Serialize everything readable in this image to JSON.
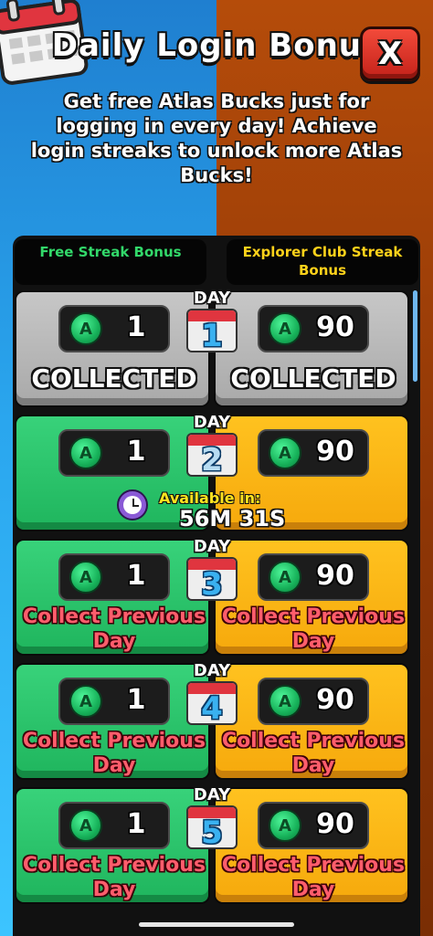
{
  "header": {
    "title": "Daily Login Bonus",
    "close_label": "X",
    "subtitle": "Get free Atlas Bucks just for logging in every day! Achieve login streaks to unlock more Atlas Bucks!"
  },
  "columns": {
    "free_header": "Free Streak Bonus",
    "club_header": "Explorer Club Streak Bonus"
  },
  "currency_icon_letter": "A",
  "days": [
    {
      "day_label": "DAY",
      "day_number": "1",
      "free_amount": "1",
      "club_amount": "90",
      "state": "collected",
      "status_text": "COLLECTED"
    },
    {
      "day_label": "DAY",
      "day_number": "2",
      "free_amount": "1",
      "club_amount": "90",
      "state": "available",
      "available_label": "Available in:",
      "available_time": "56M 31S"
    },
    {
      "day_label": "DAY",
      "day_number": "3",
      "free_amount": "1",
      "club_amount": "90",
      "state": "locked",
      "status_text": "Collect Previous Day"
    },
    {
      "day_label": "DAY",
      "day_number": "4",
      "free_amount": "1",
      "club_amount": "90",
      "state": "locked",
      "status_text": "Collect Previous Day"
    },
    {
      "day_label": "DAY",
      "day_number": "5",
      "free_amount": "1",
      "club_amount": "90",
      "state": "locked",
      "status_text": "Collect Previous Day"
    }
  ],
  "colors": {
    "left_background": "#2aa6ee",
    "right_background": "#8e3606",
    "free_header_text": "#32d96a",
    "club_header_text": "#ffd21a",
    "collected_card": "#b5b5b5",
    "free_card": "#1fb55d",
    "club_card": "#f6a90c",
    "locked_text": "#ff5d6c",
    "available_text": "#ffe41f"
  },
  "icons": {
    "calendar": "calendar-icon",
    "close": "close-icon",
    "currency": "atlas-bucks-coin-icon",
    "clock": "clock-icon"
  }
}
